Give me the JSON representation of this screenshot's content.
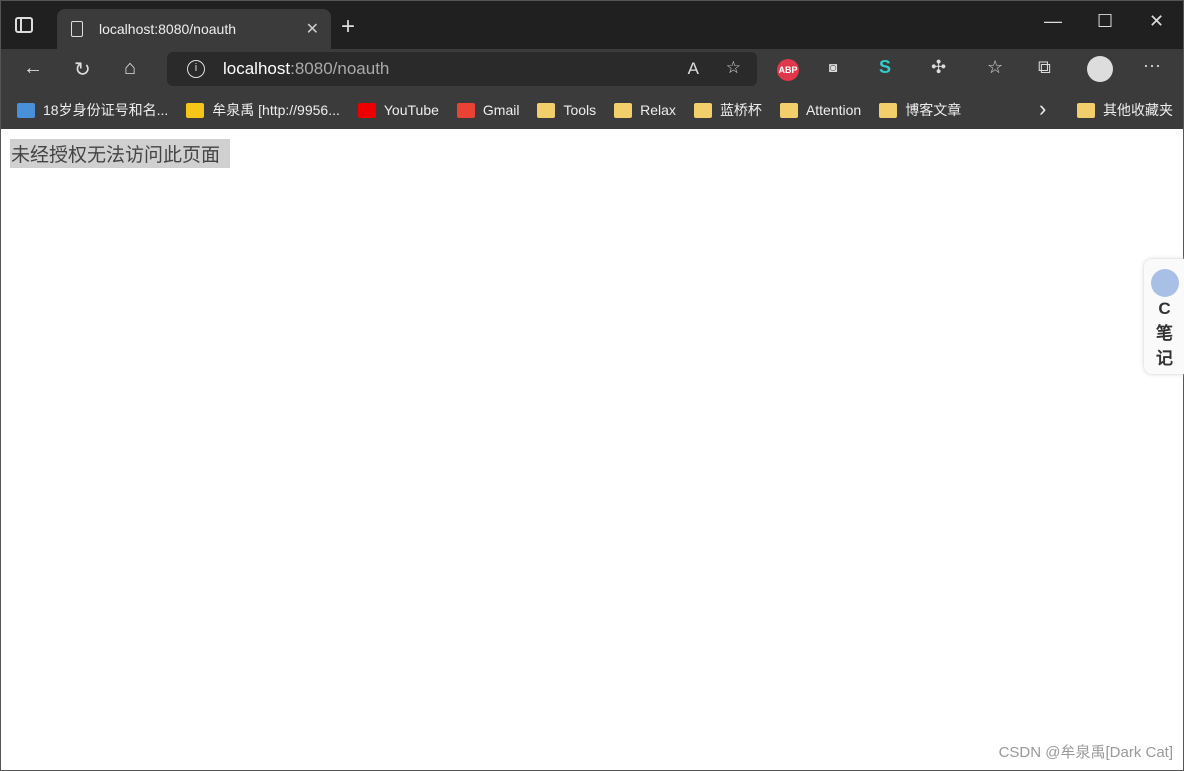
{
  "tab": {
    "title": "localhost:8080/noauth"
  },
  "address": {
    "host": "localhost",
    "path": ":8080/noauth"
  },
  "extensions": [
    "ABP",
    "ghost",
    "S2",
    "puzzle"
  ],
  "bookmarks": [
    {
      "label": "18岁身份证号和名...",
      "icon": "cha-icon",
      "color": "#4a90d9"
    },
    {
      "label": "牟泉禹 [http://9956...",
      "icon": "star-icon",
      "color": "#f5c518"
    },
    {
      "label": "YouTube",
      "icon": "youtube-icon",
      "color": "#e00"
    },
    {
      "label": "Gmail",
      "icon": "gmail-icon",
      "color": "#ea4335"
    },
    {
      "label": "Tools",
      "icon": "folder-icon"
    },
    {
      "label": "Relax",
      "icon": "folder-icon"
    },
    {
      "label": "蓝桥杯",
      "icon": "folder-icon"
    },
    {
      "label": "Attention",
      "icon": "folder-icon"
    },
    {
      "label": "博客文章",
      "icon": "folder-icon"
    }
  ],
  "other_bookmarks": "其他收藏夹",
  "page": {
    "message": "未经授权无法访问此页面"
  },
  "side_widget": {
    "l1": "C",
    "l2": "笔",
    "l3": "记"
  },
  "watermark": "CSDN @牟泉禹[Dark Cat]"
}
